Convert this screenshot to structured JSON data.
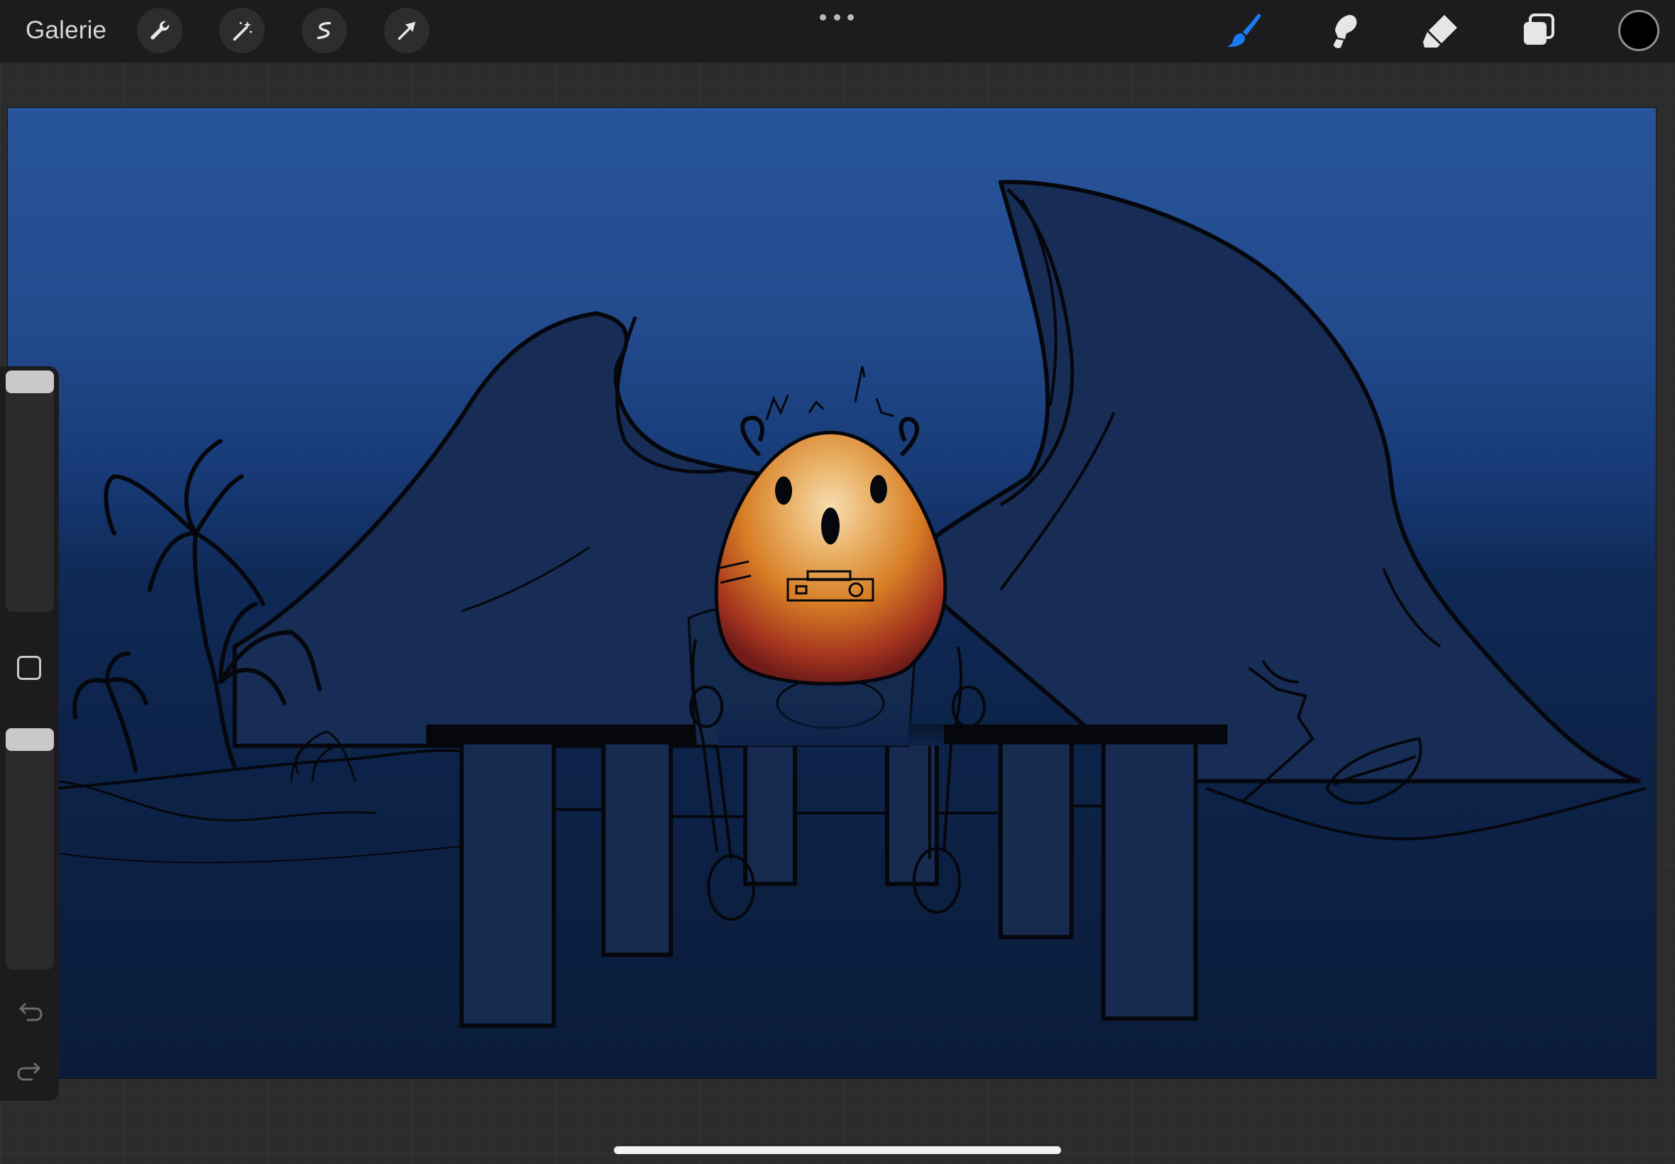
{
  "toolbar": {
    "gallery_label": "Galerie",
    "left_tools": [
      {
        "name": "wrench-icon",
        "purpose": "actions"
      },
      {
        "name": "magic-wand-icon",
        "purpose": "adjustments"
      },
      {
        "name": "selection-icon",
        "purpose": "selection"
      },
      {
        "name": "transform-arrow-icon",
        "purpose": "transform"
      }
    ],
    "more_menu": "three-dots-icon",
    "right_tools": [
      {
        "name": "brush-icon",
        "purpose": "paint",
        "active": true
      },
      {
        "name": "smudge-icon",
        "purpose": "smudge",
        "active": false
      },
      {
        "name": "eraser-icon",
        "purpose": "erase",
        "active": false
      },
      {
        "name": "layers-icon",
        "purpose": "layers",
        "active": false
      }
    ],
    "current_color": "#000000",
    "active_color": "#1a7cf5"
  },
  "sidebar": {
    "brush_size_level": 0.93,
    "opacity_level": 0.93,
    "modify_button": "square-modify-icon",
    "undo": "undo-icon",
    "redo": "redo-icon"
  },
  "artwork": {
    "description_free": true,
    "sky_top": "#27549a",
    "sky_mid": "#123065",
    "water": "#0c1d3d",
    "egg_light": "#f6d49b",
    "egg_orange": "#dd8a2a",
    "egg_red": "#9a2b1e"
  }
}
